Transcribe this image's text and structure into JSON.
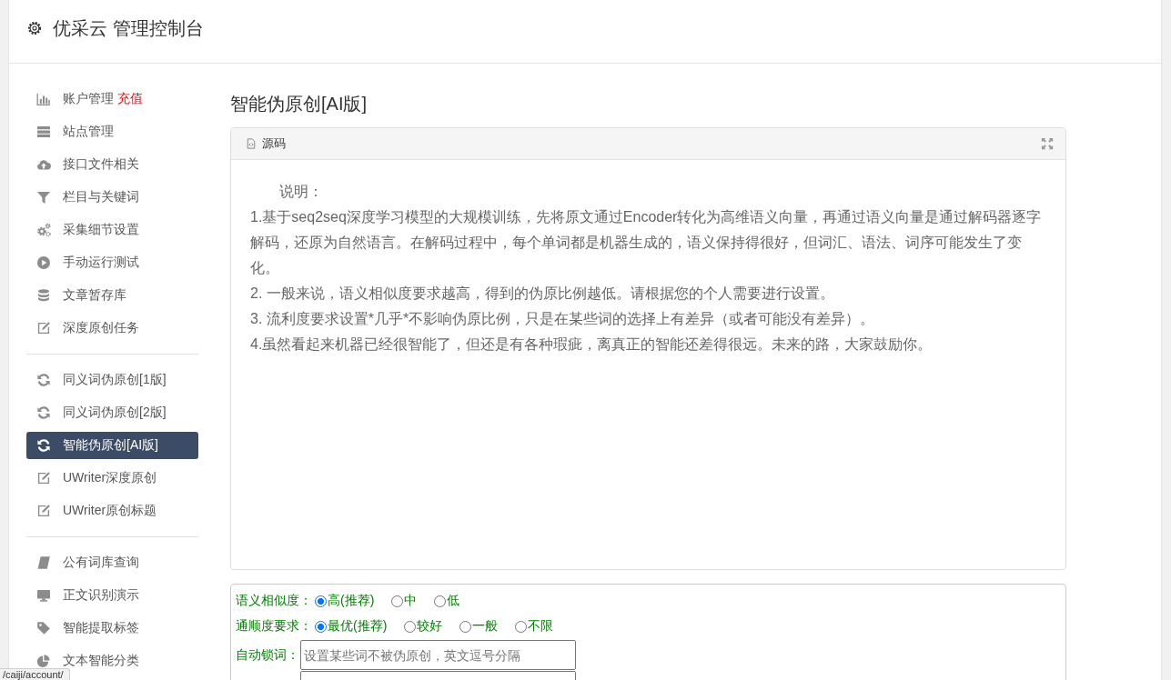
{
  "header": {
    "title": "优采云 管理控制台"
  },
  "sidebar": {
    "groups": [
      {
        "items": [
          {
            "label": "账户管理",
            "link": "充值",
            "selected": false
          },
          {
            "label": "站点管理",
            "selected": false
          },
          {
            "label": "接口文件相关",
            "selected": false
          },
          {
            "label": "栏目与关键词",
            "selected": false
          },
          {
            "label": "采集细节设置",
            "selected": false
          },
          {
            "label": "手动运行测试",
            "selected": false
          },
          {
            "label": "文章暂存库",
            "selected": false
          },
          {
            "label": "深度原创任务",
            "selected": false
          }
        ]
      },
      {
        "items": [
          {
            "label": "同义词伪原创[1版]",
            "selected": false
          },
          {
            "label": "同义词伪原创[2版]",
            "selected": false
          },
          {
            "label": "智能伪原创[AI版]",
            "selected": true
          },
          {
            "label": "UWriter深度原创",
            "selected": false
          },
          {
            "label": "UWriter原创标题",
            "selected": false
          }
        ]
      },
      {
        "items": [
          {
            "label": "公有词库查询",
            "selected": false
          },
          {
            "label": "正文识别演示",
            "selected": false
          },
          {
            "label": "智能提取标签",
            "selected": false
          },
          {
            "label": "文本智能分类",
            "selected": false
          }
        ]
      }
    ]
  },
  "page_title": "智能伪原创[AI版]",
  "source_panel": {
    "title": "源码",
    "intro": "说明：",
    "points": [
      "1.基于seq2seq深度学习模型的大规模训练，先将原文通过Encoder转化为高维语义向量，再通过语义向量是通过解码器逐字解码，还原为自然语言。在解码过程中，每个单词都是机器生成的，语义保持得很好，但词汇、语法、词序可能发生了变化。",
      "2. 一般来说，语义相似度要求越高，得到的伪原比例越低。请根据您的个人需要进行设置。",
      "3. 流利度要求设置*几乎*不影响伪原比例，只是在某些词的选择上有差异（或者可能没有差异）。",
      "4.虽然看起来机器已经很智能了，但还是有各种瑕疵，离真正的智能还差得很远。未来的路，大家鼓励你。"
    ]
  },
  "options": {
    "rows": [
      {
        "kind": "radio",
        "label": "语义相似度：",
        "options": [
          {
            "label": "高(推荐)",
            "selected": true
          },
          {
            "label": "中",
            "selected": false
          },
          {
            "label": "低",
            "selected": false
          }
        ]
      },
      {
        "kind": "radio",
        "label": "通顺度要求：",
        "options": [
          {
            "label": "最优(推荐)",
            "selected": true
          },
          {
            "label": "较好",
            "selected": false
          },
          {
            "label": "一般",
            "selected": false
          },
          {
            "label": "不限",
            "selected": false
          }
        ]
      },
      {
        "kind": "text",
        "label": "自动锁词：",
        "placeholder": "设置某些词不被伪原创，英文逗号分隔"
      },
      {
        "kind": "text"
      }
    ]
  },
  "status_url": "/caiji/account/"
}
